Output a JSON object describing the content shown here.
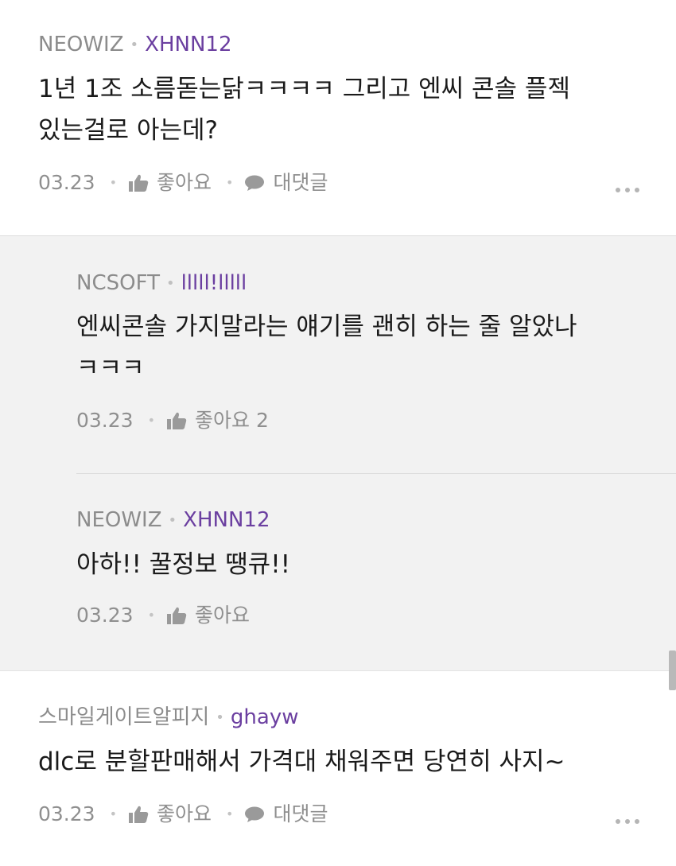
{
  "comments": [
    {
      "source": "NEOWIZ",
      "nick": "XHNN12",
      "text_lines": [
        "1년 1조 소름돋는닭ㅋㅋㅋㅋ 그리고 엔씨 콘솔 플젝",
        "있는걸로 아는데?"
      ],
      "date": "03.23",
      "like_label": "좋아요",
      "reply_label": "대댓글"
    },
    {
      "source": "스마일게이트알피지",
      "nick": "ghayw",
      "text_lines": [
        "dlc로 분할판매해서 가격대 채워주면 당연히 사지~"
      ],
      "date": "03.23",
      "like_label": "좋아요",
      "reply_label": "대댓글"
    }
  ],
  "replies": [
    {
      "source": "NCSOFT",
      "nick": "lllll!lllll",
      "text_lines": [
        "엔씨콘솔 가지말라는 얘기를 괜히 하는 줄 알았나",
        "ㅋㅋㅋ"
      ],
      "date": "03.23",
      "like_label": "좋아요 2"
    },
    {
      "source": "NEOWIZ",
      "nick": "XHNN12",
      "text_lines": [
        "아하!! 꿀정보 땡큐!!"
      ],
      "date": "03.23",
      "like_label": "좋아요"
    }
  ],
  "colors": {
    "nick": "#6b3fa0",
    "meta": "#8c8c8c",
    "reply_bg": "#f2f2f2"
  },
  "icons": [
    "thumbs-up-icon",
    "speech-bubble-icon",
    "more-dots-icon"
  ]
}
